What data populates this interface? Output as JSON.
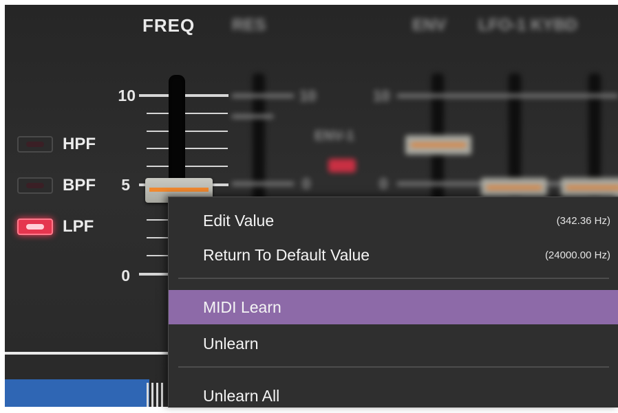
{
  "filter_section": {
    "title": "FREQ",
    "scale": {
      "max": "10",
      "mid": "5",
      "min": "0"
    },
    "slider_value_fraction": 0.42,
    "modes": [
      {
        "label": "HPF",
        "active": false
      },
      {
        "label": "BPF",
        "active": false
      },
      {
        "label": "LPF",
        "active": true
      }
    ]
  },
  "background_labels": {
    "res": "RES",
    "env": "ENV",
    "lfo_kybd": "LFO-1 KYBD",
    "env_source": "ENV-1",
    "res_scale": {
      "max": "10",
      "min": "0"
    },
    "env_scale": {
      "max": "10",
      "min": "0"
    }
  },
  "context_menu": {
    "items": [
      {
        "label": "Edit Value",
        "hint": "(342.36 Hz)"
      },
      {
        "label": "Return To Default Value",
        "hint": "(24000.00 Hz)"
      },
      {
        "label": "MIDI Learn",
        "hint": ""
      },
      {
        "label": "Unlearn",
        "hint": ""
      },
      {
        "label": "Unlearn All",
        "hint": ""
      }
    ],
    "highlighted_index": 2
  },
  "colors": {
    "menu_highlight": "#8d6aa8",
    "led_on": "#e5364f",
    "slider_stripe": "#f0882f",
    "bottom_strip": "#2f66b4"
  }
}
